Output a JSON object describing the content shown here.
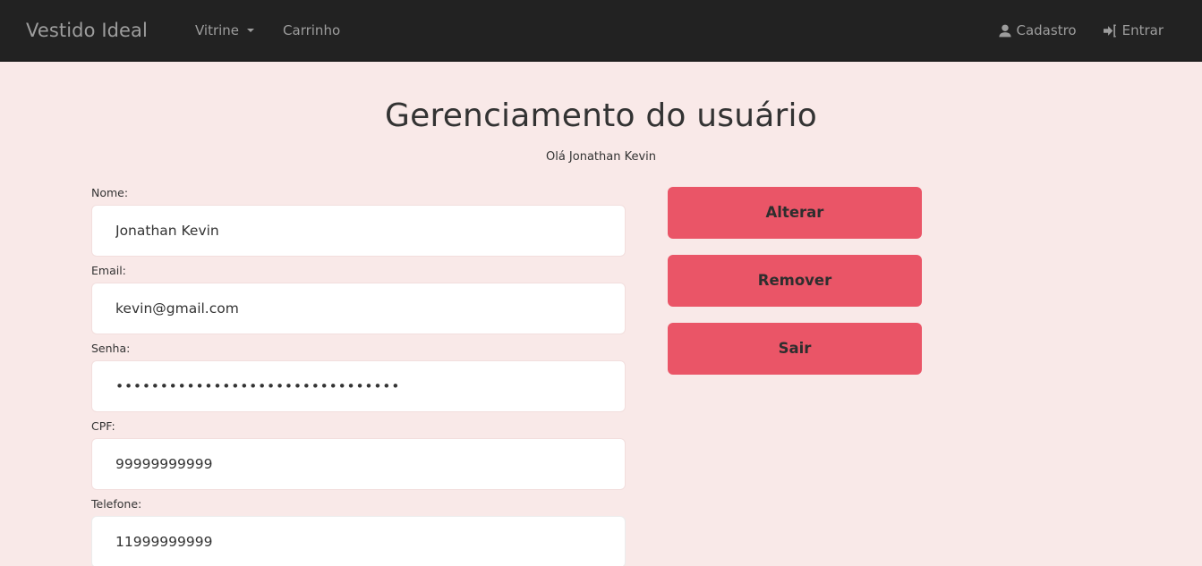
{
  "navbar": {
    "brand": "Vestido Ideal",
    "left_links": [
      {
        "label": "Vitrine",
        "icon": "chevron-down-icon",
        "has_caret": true
      },
      {
        "label": "Carrinho",
        "has_caret": false
      }
    ],
    "right_links": [
      {
        "label": "Cadastro",
        "icon": "user-icon"
      },
      {
        "label": "Entrar",
        "icon": "sign-in-icon"
      }
    ],
    "background_color": "#222222",
    "text_color": "#9d9d9d"
  },
  "page": {
    "title": "Gerenciamento do usuário",
    "subtitle": "Olá Jonathan Kevin",
    "background_color": "#f9e9e8"
  },
  "form": {
    "fields": [
      {
        "label": "Nome:",
        "value": "Jonathan Kevin",
        "type": "text",
        "focused": false
      },
      {
        "label": "Email:",
        "value": "kevin@gmail.com",
        "type": "text",
        "focused": false
      },
      {
        "label": "Senha:",
        "value": "••••••••••••••••••••••••••••••••",
        "type": "password",
        "focused": false
      },
      {
        "label": "CPF:",
        "value": "99999999999",
        "type": "text",
        "focused": false
      },
      {
        "label": "Telefone:",
        "value": "11999999999",
        "type": "text",
        "focused": true
      }
    ]
  },
  "actions": {
    "buttons": [
      {
        "label": "Alterar",
        "color": "#ea5567"
      },
      {
        "label": "Remover",
        "color": "#ea5567"
      },
      {
        "label": "Sair",
        "color": "#ea5567"
      }
    ]
  }
}
